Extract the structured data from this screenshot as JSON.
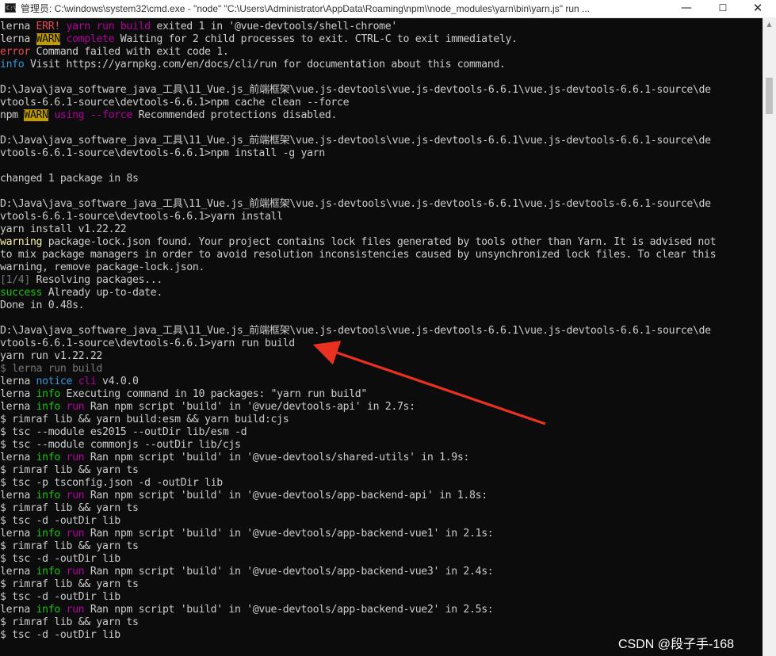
{
  "window": {
    "app_icon": "C:\\",
    "title": "管理员: C:\\windows\\system32\\cmd.exe  - \"node\"  \"C:\\Users\\Administrator\\AppData\\Roaming\\npm\\\\node_modules\\yarn\\bin\\yarn.js\" run ...",
    "minimize_glyph": "—",
    "maximize_glyph": "☐",
    "close_glyph": "✕"
  },
  "colors": {
    "background": "#0c0c0c",
    "default_text": "#cccccc",
    "error_red": "#e74856",
    "warn_bg": "#c19c00",
    "magenta": "#b4009e",
    "cyan": "#3a96dd",
    "green": "#16c60c",
    "yellow": "#f9f1a5",
    "gray": "#767676",
    "annotation_arrow": "#e8321f"
  },
  "console": {
    "lines": [
      [
        {
          "t": "lerna "
        },
        {
          "t": "ERR!",
          "c": "err"
        },
        {
          "t": " "
        },
        {
          "t": "yarn run build",
          "c": "mag"
        },
        {
          "t": " exited 1 in '@vue-devtools/shell-chrome'"
        }
      ],
      [
        {
          "t": "lerna "
        },
        {
          "t": "WARN",
          "c": "warnbg"
        },
        {
          "t": " "
        },
        {
          "t": "complete",
          "c": "mag"
        },
        {
          "t": " Waiting for 2 child processes to exit. CTRL-C to exit immediately."
        }
      ],
      [
        {
          "t": "error",
          "c": "err"
        },
        {
          "t": " Command failed with exit code 1."
        }
      ],
      [
        {
          "t": "info",
          "c": "cyan"
        },
        {
          "t": " Visit https://yarnpkg.com/en/docs/cli/run for documentation about this command."
        }
      ],
      [
        {
          "t": ""
        }
      ],
      [
        {
          "t": "D:\\Java\\java_software_java_工具\\11_Vue.js_前端框架\\vue.js-devtools\\vue.js-devtools-6.6.1\\vue.js-devtools-6.6.1-source\\de"
        }
      ],
      [
        {
          "t": "vtools-6.6.1-source\\devtools-6.6.1>npm cache clean --force"
        }
      ],
      [
        {
          "t": "npm "
        },
        {
          "t": "WARN",
          "c": "warnbg"
        },
        {
          "t": " "
        },
        {
          "t": "using",
          "c": "mag"
        },
        {
          "t": " "
        },
        {
          "t": "--force",
          "c": "mag"
        },
        {
          "t": " Recommended protections disabled."
        }
      ],
      [
        {
          "t": ""
        }
      ],
      [
        {
          "t": "D:\\Java\\java_software_java_工具\\11_Vue.js_前端框架\\vue.js-devtools\\vue.js-devtools-6.6.1\\vue.js-devtools-6.6.1-source\\de"
        }
      ],
      [
        {
          "t": "vtools-6.6.1-source\\devtools-6.6.1>npm install -g yarn"
        }
      ],
      [
        {
          "t": ""
        }
      ],
      [
        {
          "t": "changed 1 package in 8s"
        }
      ],
      [
        {
          "t": ""
        }
      ],
      [
        {
          "t": "D:\\Java\\java_software_java_工具\\11_Vue.js_前端框架\\vue.js-devtools\\vue.js-devtools-6.6.1\\vue.js-devtools-6.6.1-source\\de"
        }
      ],
      [
        {
          "t": "vtools-6.6.1-source\\devtools-6.6.1>yarn install"
        }
      ],
      [
        {
          "t": "yarn install v1.22.22"
        }
      ],
      [
        {
          "t": "warning",
          "c": "yellow"
        },
        {
          "t": " package-lock.json found. Your project contains lock files generated by tools other than Yarn. It is advised not"
        }
      ],
      [
        {
          "t": "to mix package managers in order to avoid resolution inconsistencies caused by unsynchronized lock files. To clear this"
        }
      ],
      [
        {
          "t": "warning, remove package-lock.json."
        }
      ],
      [
        {
          "t": "[1/4]",
          "c": "gray"
        },
        {
          "t": " Resolving packages..."
        }
      ],
      [
        {
          "t": "success",
          "c": "green"
        },
        {
          "t": " Already up-to-date."
        }
      ],
      [
        {
          "t": "Done in 0.48s."
        }
      ],
      [
        {
          "t": ""
        }
      ],
      [
        {
          "t": "D:\\Java\\java_software_java_工具\\11_Vue.js_前端框架\\vue.js-devtools\\vue.js-devtools-6.6.1\\vue.js-devtools-6.6.1-source\\de"
        }
      ],
      [
        {
          "t": "vtools-6.6.1-source\\devtools-6.6.1>yarn run build"
        }
      ],
      [
        {
          "t": "yarn run v1.22.22"
        }
      ],
      [
        {
          "t": "$ lerna run build",
          "c": "gray"
        }
      ],
      [
        {
          "t": "lerna "
        },
        {
          "t": "notice",
          "c": "cyan"
        },
        {
          "t": " "
        },
        {
          "t": "cli",
          "c": "mag"
        },
        {
          "t": " v4.0.0"
        }
      ],
      [
        {
          "t": "lerna "
        },
        {
          "t": "info",
          "c": "green"
        },
        {
          "t": " Executing command in 10 packages: \"yarn run build\""
        }
      ],
      [
        {
          "t": "lerna "
        },
        {
          "t": "info",
          "c": "green"
        },
        {
          "t": " "
        },
        {
          "t": "run",
          "c": "mag"
        },
        {
          "t": " Ran npm script 'build' in '@vue/devtools-api' in 2.7s:"
        }
      ],
      [
        {
          "t": "$ rimraf lib && yarn build:esm && yarn build:cjs"
        }
      ],
      [
        {
          "t": "$ tsc --module es2015 --outDir lib/esm -d"
        }
      ],
      [
        {
          "t": "$ tsc --module commonjs --outDir lib/cjs"
        }
      ],
      [
        {
          "t": "lerna "
        },
        {
          "t": "info",
          "c": "green"
        },
        {
          "t": " "
        },
        {
          "t": "run",
          "c": "mag"
        },
        {
          "t": " Ran npm script 'build' in '@vue-devtools/shared-utils' in 1.9s:"
        }
      ],
      [
        {
          "t": "$ rimraf lib && yarn ts"
        }
      ],
      [
        {
          "t": "$ tsc -p tsconfig.json -d -outDir lib"
        }
      ],
      [
        {
          "t": "lerna "
        },
        {
          "t": "info",
          "c": "green"
        },
        {
          "t": " "
        },
        {
          "t": "run",
          "c": "mag"
        },
        {
          "t": " Ran npm script 'build' in '@vue-devtools/app-backend-api' in 1.8s:"
        }
      ],
      [
        {
          "t": "$ rimraf lib && yarn ts"
        }
      ],
      [
        {
          "t": "$ tsc -d -outDir lib"
        }
      ],
      [
        {
          "t": "lerna "
        },
        {
          "t": "info",
          "c": "green"
        },
        {
          "t": " "
        },
        {
          "t": "run",
          "c": "mag"
        },
        {
          "t": " Ran npm script 'build' in '@vue-devtools/app-backend-vue1' in 2.1s:"
        }
      ],
      [
        {
          "t": "$ rimraf lib && yarn ts"
        }
      ],
      [
        {
          "t": "$ tsc -d -outDir lib"
        }
      ],
      [
        {
          "t": "lerna "
        },
        {
          "t": "info",
          "c": "green"
        },
        {
          "t": " "
        },
        {
          "t": "run",
          "c": "mag"
        },
        {
          "t": " Ran npm script 'build' in '@vue-devtools/app-backend-vue3' in 2.4s:"
        }
      ],
      [
        {
          "t": "$ rimraf lib && yarn ts"
        }
      ],
      [
        {
          "t": "$ tsc -d -outDir lib"
        }
      ],
      [
        {
          "t": "lerna "
        },
        {
          "t": "info",
          "c": "green"
        },
        {
          "t": " "
        },
        {
          "t": "run",
          "c": "mag"
        },
        {
          "t": " Ran npm script 'build' in '@vue-devtools/app-backend-vue2' in 2.5s:"
        }
      ],
      [
        {
          "t": "$ rimraf lib && yarn ts"
        }
      ],
      [
        {
          "t": "$ tsc -d -outDir lib"
        }
      ]
    ]
  },
  "watermark": "CSDN @段子手-168"
}
